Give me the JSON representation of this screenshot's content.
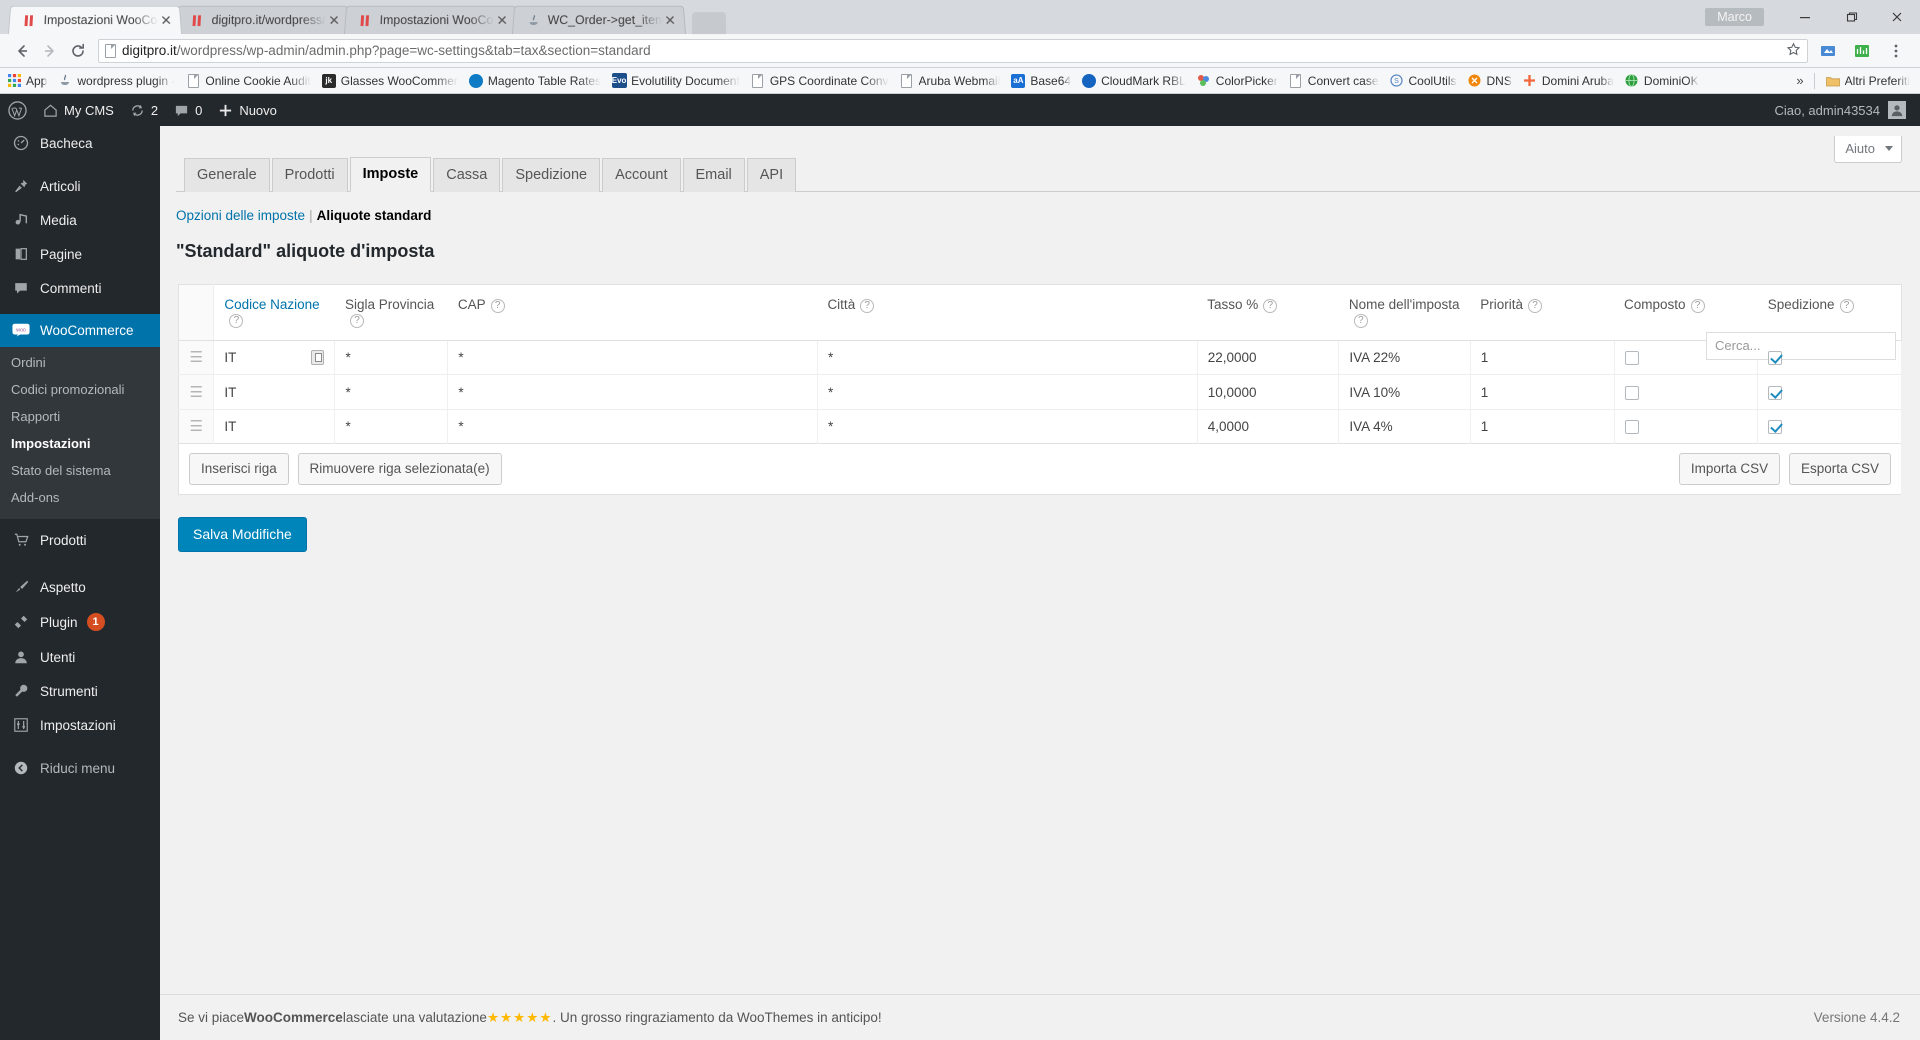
{
  "browser": {
    "tabs": [
      {
        "title": "Impostazioni WooComme",
        "favicon": "woocommerce-icon",
        "active": true
      },
      {
        "title": "digitpro.it/wordpress/?fee",
        "favicon": "woocommerce-icon",
        "active": false
      },
      {
        "title": "Impostazioni WooComme",
        "favicon": "woocommerce-icon",
        "active": false
      },
      {
        "title": "WC_Order->get_items() n",
        "favicon": "java-icon",
        "active": false
      }
    ],
    "new_tab_label": "new-tab",
    "user_chip": "Marco",
    "window_controls": [
      "minimize",
      "maximize",
      "close"
    ],
    "nav": {
      "back": "back-arrow",
      "forward": "forward-arrow",
      "reload": "reload-icon"
    },
    "url_host": "digitpro.it",
    "url_path": "/wordpress/wp-admin/admin.php?page=wc-settings&tab=tax&section=standard",
    "bookmarks": [
      {
        "label": "App",
        "icon": "apps-grid-icon"
      },
      {
        "label": "wordpress plugin - W",
        "icon": "java-icon"
      },
      {
        "label": "Online Cookie Audit",
        "icon": "page-icon"
      },
      {
        "label": "Glasses  WooCommer",
        "icon": "jk-icon"
      },
      {
        "label": "Magento Table Rates",
        "icon": "drupal-icon"
      },
      {
        "label": "Evolutility  Document",
        "icon": "evo-icon"
      },
      {
        "label": "GPS Coordinate Conv",
        "icon": "page-icon"
      },
      {
        "label": "Aruba Webmail",
        "icon": "page-icon"
      },
      {
        "label": "Base64",
        "icon": "aa-icon"
      },
      {
        "label": "CloudMark RBL",
        "icon": "cloudmark-icon"
      },
      {
        "label": "ColorPicker",
        "icon": "colorpicker-icon"
      },
      {
        "label": "Convert case",
        "icon": "page-icon"
      },
      {
        "label": "CoolUtils",
        "icon": "coolutils-icon"
      },
      {
        "label": "DNS",
        "icon": "dns-icon"
      },
      {
        "label": "Domini Aruba",
        "icon": "aruba-icon"
      },
      {
        "label": "DominiOK",
        "icon": "globe-icon"
      }
    ],
    "bookmarks_overflow": "»",
    "other_bookmarks": {
      "label": "Altri Preferiti",
      "icon": "folder-icon"
    }
  },
  "adminbar": {
    "logo": "wordpress-logo-icon",
    "site_name": "My CMS",
    "updates_count": "2",
    "comments_count": "0",
    "new_label": "Nuovo",
    "greeting": "Ciao, admin43534"
  },
  "sidebar": {
    "items": [
      {
        "label": "Bacheca",
        "icon": "dashboard-icon"
      },
      {
        "label": "Articoli",
        "icon": "pin-icon"
      },
      {
        "label": "Media",
        "icon": "media-icon"
      },
      {
        "label": "Pagine",
        "icon": "pages-icon"
      },
      {
        "label": "Commenti",
        "icon": "comment-icon"
      },
      {
        "label": "WooCommerce",
        "icon": "woocommerce-icon",
        "current": true
      },
      {
        "label": "Prodotti",
        "icon": "cart-icon"
      },
      {
        "label": "Aspetto",
        "icon": "brush-icon"
      },
      {
        "label": "Plugin",
        "icon": "plug-icon",
        "badge": "1"
      },
      {
        "label": "Utenti",
        "icon": "user-icon"
      },
      {
        "label": "Strumenti",
        "icon": "wrench-icon"
      },
      {
        "label": "Impostazioni",
        "icon": "settings-icon"
      }
    ],
    "submenu": [
      {
        "label": "Ordini"
      },
      {
        "label": "Codici promozionali"
      },
      {
        "label": "Rapporti"
      },
      {
        "label": "Impostazioni",
        "current": true
      },
      {
        "label": "Stato del sistema"
      },
      {
        "label": "Add-ons"
      }
    ],
    "collapse_label": "Riduci menu"
  },
  "screen_options": {
    "help_label": "Aiuto"
  },
  "main": {
    "tabs": [
      {
        "label": "Generale"
      },
      {
        "label": "Prodotti"
      },
      {
        "label": "Imposte",
        "active": true
      },
      {
        "label": "Cassa"
      },
      {
        "label": "Spedizione"
      },
      {
        "label": "Account"
      },
      {
        "label": "Email"
      },
      {
        "label": "API"
      }
    ],
    "subnav": {
      "link": "Opzioni delle imposte",
      "separator": "|",
      "current": "Aliquote standard"
    },
    "page_title": "\"Standard\" aliquote d'imposta",
    "search_placeholder": "Cerca...",
    "columns": [
      {
        "label": "Codice Nazione",
        "help": true,
        "link": true
      },
      {
        "label": "Sigla Provincia",
        "help": true
      },
      {
        "label": "CAP",
        "help": true
      },
      {
        "label": "Città",
        "help": true
      },
      {
        "label": "Tasso %",
        "help": true
      },
      {
        "label": "Nome dell'imposta",
        "help": true
      },
      {
        "label": "Priorità",
        "help": true
      },
      {
        "label": "Composto",
        "help": true
      },
      {
        "label": "Spedizione",
        "help": true
      }
    ],
    "rows": [
      {
        "country": "IT",
        "state": "*",
        "postcode": "*",
        "city": "*",
        "rate": "22,0000",
        "name": "IVA 22%",
        "priority": "1",
        "compound": false,
        "shipping": true,
        "has_flag_button": true
      },
      {
        "country": "IT",
        "state": "*",
        "postcode": "*",
        "city": "*",
        "rate": "10,0000",
        "name": "IVA 10%",
        "priority": "1",
        "compound": false,
        "shipping": true,
        "has_flag_button": false
      },
      {
        "country": "IT",
        "state": "*",
        "postcode": "*",
        "city": "*",
        "rate": "4,0000",
        "name": "IVA 4%",
        "priority": "1",
        "compound": false,
        "shipping": true,
        "has_flag_button": false
      }
    ],
    "table_footer": {
      "insert_row": "Inserisci riga",
      "remove_rows": "Rimuovere riga selezionata(e)",
      "import_csv": "Importa CSV",
      "export_csv": "Esporta CSV"
    },
    "save_button": "Salva Modifiche"
  },
  "footer": {
    "text_before": "Se vi piace ",
    "brand": "WooCommerce",
    "text_mid": " lasciate una valutazione ",
    "stars": "★★★★★",
    "text_after": ". Un grosso ringraziamento da WooThemes in anticipo!",
    "version": "Versione 4.4.2"
  },
  "colors": {
    "accent": "#0073aa",
    "primary_button": "#0085ba",
    "admin_dark": "#23282d",
    "submenu_bg": "#32373c",
    "badge": "#d54e21",
    "star": "#ffb900"
  }
}
